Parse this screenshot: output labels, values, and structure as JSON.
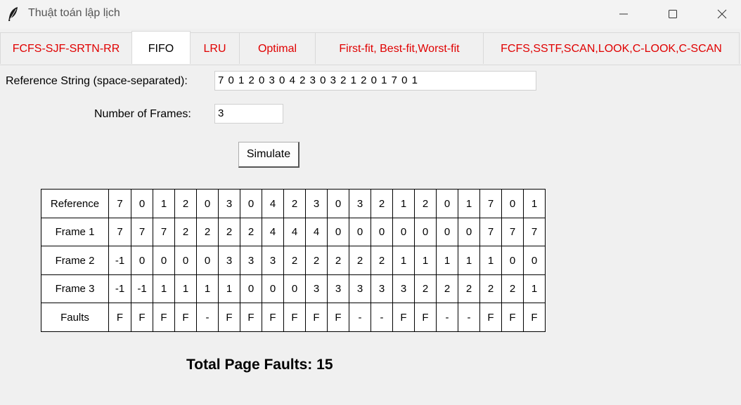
{
  "window": {
    "title": "Thuật toán lập lịch"
  },
  "tabs": [
    {
      "label": "FCFS-SJF-SRTN-RR",
      "active": false
    },
    {
      "label": "FIFO",
      "active": true
    },
    {
      "label": "LRU",
      "active": false
    },
    {
      "label": "Optimal",
      "active": false
    },
    {
      "label": "First-fit, Best-fit,Worst-fit",
      "active": false
    },
    {
      "label": "FCFS,SSTF,SCAN,LOOK,C-LOOK,C-SCAN",
      "active": false
    }
  ],
  "form": {
    "reference_label": "Reference String (space-separated):",
    "reference_value": "7 0 1 2 0 3 0 4 2 3 0 3 2 1 2 0 1 7 0 1",
    "frames_label": "Number of Frames:",
    "frames_value": "3",
    "simulate_label": "Simulate"
  },
  "table": {
    "rows": [
      {
        "label": "Reference",
        "values": [
          "7",
          "0",
          "1",
          "2",
          "0",
          "3",
          "0",
          "4",
          "2",
          "3",
          "0",
          "3",
          "2",
          "1",
          "2",
          "0",
          "1",
          "7",
          "0",
          "1"
        ]
      },
      {
        "label": "Frame 1",
        "values": [
          "7",
          "7",
          "7",
          "2",
          "2",
          "2",
          "2",
          "4",
          "4",
          "4",
          "0",
          "0",
          "0",
          "0",
          "0",
          "0",
          "0",
          "7",
          "7",
          "7"
        ]
      },
      {
        "label": "Frame 2",
        "values": [
          "-1",
          "0",
          "0",
          "0",
          "0",
          "3",
          "3",
          "3",
          "2",
          "2",
          "2",
          "2",
          "2",
          "1",
          "1",
          "1",
          "1",
          "1",
          "0",
          "0"
        ]
      },
      {
        "label": "Frame 3",
        "values": [
          "-1",
          "-1",
          "1",
          "1",
          "1",
          "1",
          "0",
          "0",
          "0",
          "3",
          "3",
          "3",
          "3",
          "3",
          "2",
          "2",
          "2",
          "2",
          "2",
          "1"
        ]
      },
      {
        "label": "Faults",
        "values": [
          "F",
          "F",
          "F",
          "F",
          "-",
          "F",
          "F",
          "F",
          "F",
          "F",
          "F",
          "-",
          "-",
          "F",
          "F",
          "-",
          "-",
          "F",
          "F",
          "F"
        ]
      }
    ]
  },
  "summary": "Total Page Faults: 15",
  "colors": {
    "tab_text": "#e00000",
    "background": "#f0f0f0"
  }
}
